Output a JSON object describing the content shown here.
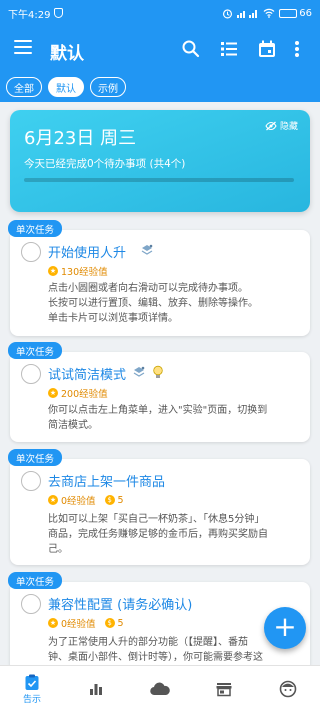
{
  "status_bar": {
    "time": "下午4:29",
    "battery": "66"
  },
  "app_bar": {
    "title": "默认",
    "icons": [
      "menu-icon",
      "search-icon",
      "list-icon",
      "calendar-icon",
      "more-icon"
    ]
  },
  "chips": [
    {
      "label": "全部",
      "active": false
    },
    {
      "label": "默认",
      "active": true
    },
    {
      "label": "示例",
      "active": false
    }
  ],
  "hero": {
    "date": "6月23日 周三",
    "hide_label": "隐藏",
    "summary": "今天已经完成0个待办事项 (共4个)",
    "progress": 0
  },
  "tasks": [
    {
      "tag": "单次任务",
      "title": "开始使用人升",
      "exp": "130经验值",
      "coins": "",
      "desc": [
        "点击小圆圈或者向右滑动可以完成待办事项。",
        "长按可以进行置顶、编辑、放弃、删除等操作。",
        "单击卡片可以浏览事项详情。"
      ]
    },
    {
      "tag": "单次任务",
      "title": "试试简洁模式",
      "exp": "200经验值",
      "coins": "",
      "desc": [
        "你可以点击左上角菜单，进入\"实验\"页面，切换到",
        "简洁模式。"
      ]
    },
    {
      "tag": "单次任务",
      "title": "去商店上架一件商品",
      "exp": "0经验值",
      "coins": "5",
      "desc": [
        "比如可以上架「买自己一杯奶茶」、「休息5分钟」",
        "商品，完成任务赚够足够的金币后，再购买奖励自",
        "己。"
      ]
    },
    {
      "tag": "单次任务",
      "title": "兼容性配置 (请务必确认)",
      "exp": "0经验值",
      "coins": "5",
      "desc": [
        "为了正常使用人升的部分功能（【提醒】、番茄",
        "钟、桌面小部件、倒计时等），你可能需要参考这"
      ]
    }
  ],
  "fab": {
    "label": "+"
  },
  "bottom_nav": [
    {
      "label": "告示",
      "icon": "notice-icon",
      "active": true
    },
    {
      "label": "",
      "icon": "stats-icon",
      "active": false
    },
    {
      "label": "",
      "icon": "cloud-icon",
      "active": false
    },
    {
      "label": "",
      "icon": "shop-icon",
      "active": false
    },
    {
      "label": "",
      "icon": "face-icon",
      "active": false
    }
  ],
  "colors": {
    "primary": "#2196f3",
    "hero_start": "#3fd0f0",
    "hero_end": "#28b6df",
    "exp": "#e08a00",
    "coin": "#ffb300"
  }
}
